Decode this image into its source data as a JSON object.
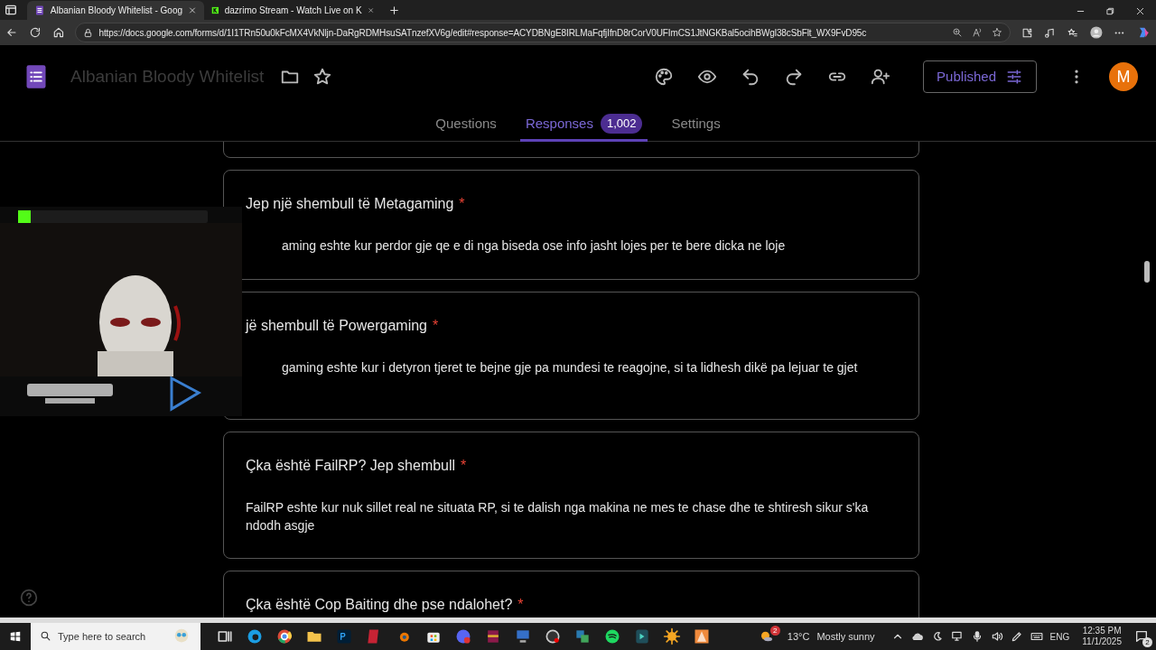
{
  "browser": {
    "tabs": [
      {
        "title": "Albanian Bloody Whitelist - Goog",
        "kind": "forms",
        "selected": true
      },
      {
        "title": "dazrimo Stream - Watch Live on K",
        "kind": "kick",
        "selected": false
      }
    ],
    "url": "https://docs.google.com/forms/d/1I1TRn50u0kFcMX4VkNljn-DaRgRDMHsuSATnzefXV6g/edit#response=ACYDBNgE8IRLMaFqfjIfnD8rCorV0UFImCS1JtNGKBal5ocihBWgl38cSbFlt_WX9FvD95c"
  },
  "form": {
    "title": "Albanian Bloody Whitelist",
    "publish_button": "Published",
    "avatar": "M",
    "tabs": [
      {
        "label": "Questions",
        "selected": false
      },
      {
        "label": "Responses",
        "selected": true,
        "count": "1,002"
      },
      {
        "label": "Settings",
        "selected": false
      }
    ]
  },
  "questions": [
    {
      "title": "Jep një shembull të Metagaming",
      "required_mark": "*",
      "answer": "aming eshte kur perdor gje qe e di nga biseda ose info jasht lojes per te bere dicka ne loje",
      "clipped": true
    },
    {
      "title": "jë shembull të Powergaming",
      "required_mark": "*",
      "answer": "gaming eshte kur i detyron tjeret te bejne gje pa mundesi te reagojne, si ta lidhesh dikë pa lejuar te gjet",
      "clipped": true
    },
    {
      "title": "Çka është FailRP? Jep shembull",
      "required_mark": "*",
      "answer": "FailRP eshte kur nuk sillet real ne situata RP, si te dalish nga makina ne mes te chase dhe te shtiresh sikur s'ka ndodh asgje",
      "clipped": false
    },
    {
      "title": "Çka është Cop Baiting dhe pse ndalohet?",
      "required_mark": "*"
    }
  ],
  "taskbar": {
    "search_placeholder": "Type here to search",
    "weather": "13°C",
    "weather_text": "Mostly sunny",
    "weather_badge": "2",
    "language": "ENG",
    "time": "12:35 PM",
    "date": "11/1/2025",
    "notifications": "2"
  }
}
